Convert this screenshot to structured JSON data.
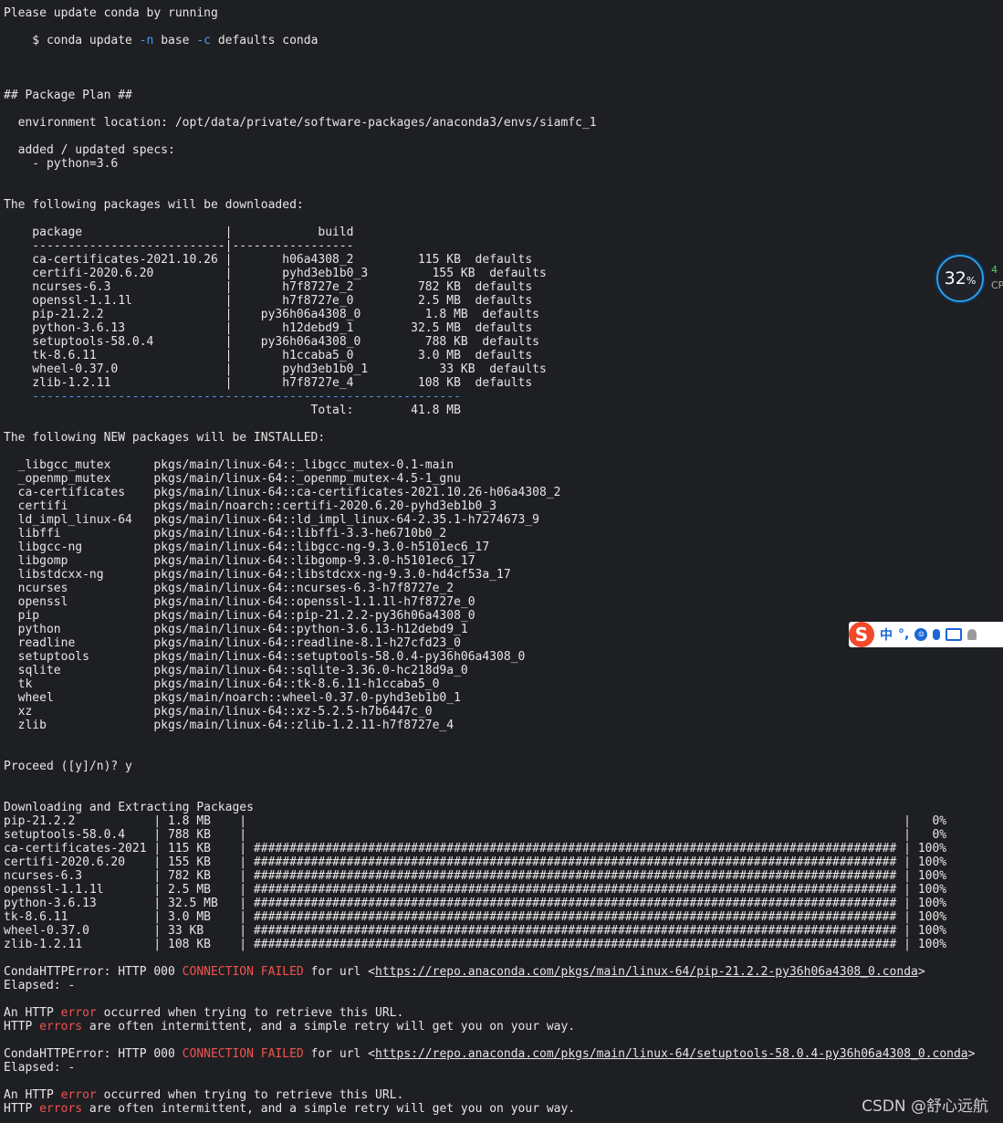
{
  "terminal": {
    "lines": [
      [
        {
          "t": "Please update conda by running"
        }
      ],
      [],
      [
        {
          "t": "    $ conda update "
        },
        {
          "t": "-n",
          "c": "blue"
        },
        {
          "t": " base "
        },
        {
          "t": "-c",
          "c": "blue"
        },
        {
          "t": " defaults conda"
        }
      ],
      [],
      [],
      [],
      [
        {
          "t": "## Package Plan ##"
        }
      ],
      [],
      [
        {
          "t": "  environment location: /opt/data/private/software-packages/anaconda3/envs/siamfc_1"
        }
      ],
      [],
      [
        {
          "t": "  added / updated specs:"
        }
      ],
      [
        {
          "t": "    - python=3.6"
        }
      ],
      [],
      [],
      [
        {
          "t": "The following packages will be downloaded:"
        }
      ],
      [],
      [
        {
          "t": "    package                    |            build"
        }
      ],
      [
        {
          "t": "    ---------------------------|-----------------"
        }
      ],
      [
        {
          "t": "    ca-certificates-2021.10.26 |       h06a4308_2         115 KB  defaults"
        }
      ],
      [
        {
          "t": "    certifi-2020.6.20          |       pyhd3eb1b0_3         155 KB  defaults"
        }
      ],
      [
        {
          "t": "    ncurses-6.3                |       h7f8727e_2         782 KB  defaults"
        }
      ],
      [
        {
          "t": "    openssl-1.1.1l             |       h7f8727e_0         2.5 MB  defaults"
        }
      ],
      [
        {
          "t": "    pip-21.2.2                 |    py36h06a4308_0         1.8 MB  defaults"
        }
      ],
      [
        {
          "t": "    python-3.6.13              |       h12debd9_1        32.5 MB  defaults"
        }
      ],
      [
        {
          "t": "    setuptools-58.0.4          |    py36h06a4308_0         788 KB  defaults"
        }
      ],
      [
        {
          "t": "    tk-8.6.11                  |       h1ccaba5_0         3.0 MB  defaults"
        }
      ],
      [
        {
          "t": "    wheel-0.37.0               |       pyhd3eb1b0_1          33 KB  defaults"
        }
      ],
      [
        {
          "t": "    zlib-1.2.11                |       h7f8727e_4         108 KB  defaults"
        }
      ],
      [
        {
          "t": "    ------------------------------------------------------------",
          "c": "blue"
        }
      ],
      [
        {
          "t": "                                           Total:        41.8 MB"
        }
      ],
      [],
      [
        {
          "t": "The following NEW packages will be INSTALLED:"
        }
      ],
      [],
      [
        {
          "t": "  _libgcc_mutex      pkgs/main/linux-64::_libgcc_mutex-0.1-main"
        }
      ],
      [
        {
          "t": "  _openmp_mutex      pkgs/main/linux-64::_openmp_mutex-4.5-1_gnu"
        }
      ],
      [
        {
          "t": "  ca-certificates    pkgs/main/linux-64::ca-certificates-2021.10.26-h06a4308_2"
        }
      ],
      [
        {
          "t": "  certifi            pkgs/main/noarch::certifi-2020.6.20-pyhd3eb1b0_3"
        }
      ],
      [
        {
          "t": "  ld_impl_linux-64   pkgs/main/linux-64::ld_impl_linux-64-2.35.1-h7274673_9"
        }
      ],
      [
        {
          "t": "  libffi             pkgs/main/linux-64::libffi-3.3-he6710b0_2"
        }
      ],
      [
        {
          "t": "  libgcc-ng          pkgs/main/linux-64::libgcc-ng-9.3.0-h5101ec6_17"
        }
      ],
      [
        {
          "t": "  libgomp            pkgs/main/linux-64::libgomp-9.3.0-h5101ec6_17"
        }
      ],
      [
        {
          "t": "  libstdcxx-ng       pkgs/main/linux-64::libstdcxx-ng-9.3.0-hd4cf53a_17"
        }
      ],
      [
        {
          "t": "  ncurses            pkgs/main/linux-64::ncurses-6.3-h7f8727e_2"
        }
      ],
      [
        {
          "t": "  openssl            pkgs/main/linux-64::openssl-1.1.1l-h7f8727e_0"
        }
      ],
      [
        {
          "t": "  pip                pkgs/main/linux-64::pip-21.2.2-py36h06a4308_0"
        }
      ],
      [
        {
          "t": "  python             pkgs/main/linux-64::python-3.6.13-h12debd9_1"
        }
      ],
      [
        {
          "t": "  readline           pkgs/main/linux-64::readline-8.1-h27cfd23_0"
        }
      ],
      [
        {
          "t": "  setuptools         pkgs/main/linux-64::setuptools-58.0.4-py36h06a4308_0"
        }
      ],
      [
        {
          "t": "  sqlite             pkgs/main/linux-64::sqlite-3.36.0-hc218d9a_0"
        }
      ],
      [
        {
          "t": "  tk                 pkgs/main/linux-64::tk-8.6.11-h1ccaba5_0"
        }
      ],
      [
        {
          "t": "  wheel              pkgs/main/noarch::wheel-0.37.0-pyhd3eb1b0_1"
        }
      ],
      [
        {
          "t": "  xz                 pkgs/main/linux-64::xz-5.2.5-h7b6447c_0"
        }
      ],
      [
        {
          "t": "  zlib               pkgs/main/linux-64::zlib-1.2.11-h7f8727e_4"
        }
      ],
      [],
      [],
      [
        {
          "t": "Proceed ([y]/n)? y"
        }
      ],
      [],
      [],
      [
        {
          "t": "Downloading and Extracting Packages"
        }
      ],
      [
        {
          "t": "pip-21.2.2           | 1.8 MB    |                                                                                            |   0% "
        }
      ],
      [
        {
          "t": "setuptools-58.0.4    | 788 KB    |                                                                                            |   0% "
        }
      ],
      [
        {
          "t": "ca-certificates-2021 | 115 KB    | ########################################################################################## | 100% "
        }
      ],
      [
        {
          "t": "certifi-2020.6.20    | 155 KB    | ########################################################################################## | 100% "
        }
      ],
      [
        {
          "t": "ncurses-6.3          | 782 KB    | ########################################################################################## | 100% "
        }
      ],
      [
        {
          "t": "openssl-1.1.1l       | 2.5 MB    | ########################################################################################## | 100% "
        }
      ],
      [
        {
          "t": "python-3.6.13        | 32.5 MB   | ########################################################################################## | 100% "
        }
      ],
      [
        {
          "t": "tk-8.6.11            | 3.0 MB    | ########################################################################################## | 100% "
        }
      ],
      [
        {
          "t": "wheel-0.37.0         | 33 KB     | ########################################################################################## | 100% "
        }
      ],
      [
        {
          "t": "zlib-1.2.11          | 108 KB    | ########################################################################################## | 100% "
        }
      ],
      [],
      [
        {
          "t": "CondaHTTPError: HTTP 000 "
        },
        {
          "t": "CONNECTION FAILED",
          "c": "red"
        },
        {
          "t": " for url <"
        },
        {
          "t": "https://repo.anaconda.com/pkgs/main/linux-64/pip-21.2.2-py36h06a4308_0.conda",
          "c": "url"
        },
        {
          "t": ">"
        }
      ],
      [
        {
          "t": "Elapsed: -"
        }
      ],
      [],
      [
        {
          "t": "An HTTP "
        },
        {
          "t": "error",
          "c": "red"
        },
        {
          "t": " occurred when trying to retrieve this URL."
        }
      ],
      [
        {
          "t": "HTTP "
        },
        {
          "t": "errors",
          "c": "red"
        },
        {
          "t": " are often intermittent, and a simple retry will get you on your way."
        }
      ],
      [],
      [
        {
          "t": "CondaHTTPError: HTTP 000 "
        },
        {
          "t": "CONNECTION FAILED",
          "c": "red"
        },
        {
          "t": " for url <"
        },
        {
          "t": "https://repo.anaconda.com/pkgs/main/linux-64/setuptools-58.0.4-py36h06a4308_0.conda",
          "c": "url"
        },
        {
          "t": ">"
        }
      ],
      [
        {
          "t": "Elapsed: -"
        }
      ],
      [],
      [
        {
          "t": "An HTTP "
        },
        {
          "t": "error",
          "c": "red"
        },
        {
          "t": " occurred when trying to retrieve this URL."
        }
      ],
      [
        {
          "t": "HTTP "
        },
        {
          "t": "errors",
          "c": "red"
        },
        {
          "t": " are often intermittent, and a simple retry will get you on your way."
        }
      ]
    ]
  },
  "cpu_widget": {
    "value": "32",
    "unit": "%",
    "side_value": "4",
    "side_label": "CP"
  },
  "ime_toolbar": {
    "logo": "S",
    "mode": "中",
    "punct": "°,",
    "icons": [
      "emoji-icon",
      "mic-icon",
      "keyboard-icon",
      "user-icon"
    ]
  },
  "watermark": "CSDN @舒心远航",
  "colors": {
    "background": "#1e1f22",
    "text": "#e6e6e6",
    "option_blue": "#4a9cf6",
    "error_red": "#f0524f"
  }
}
